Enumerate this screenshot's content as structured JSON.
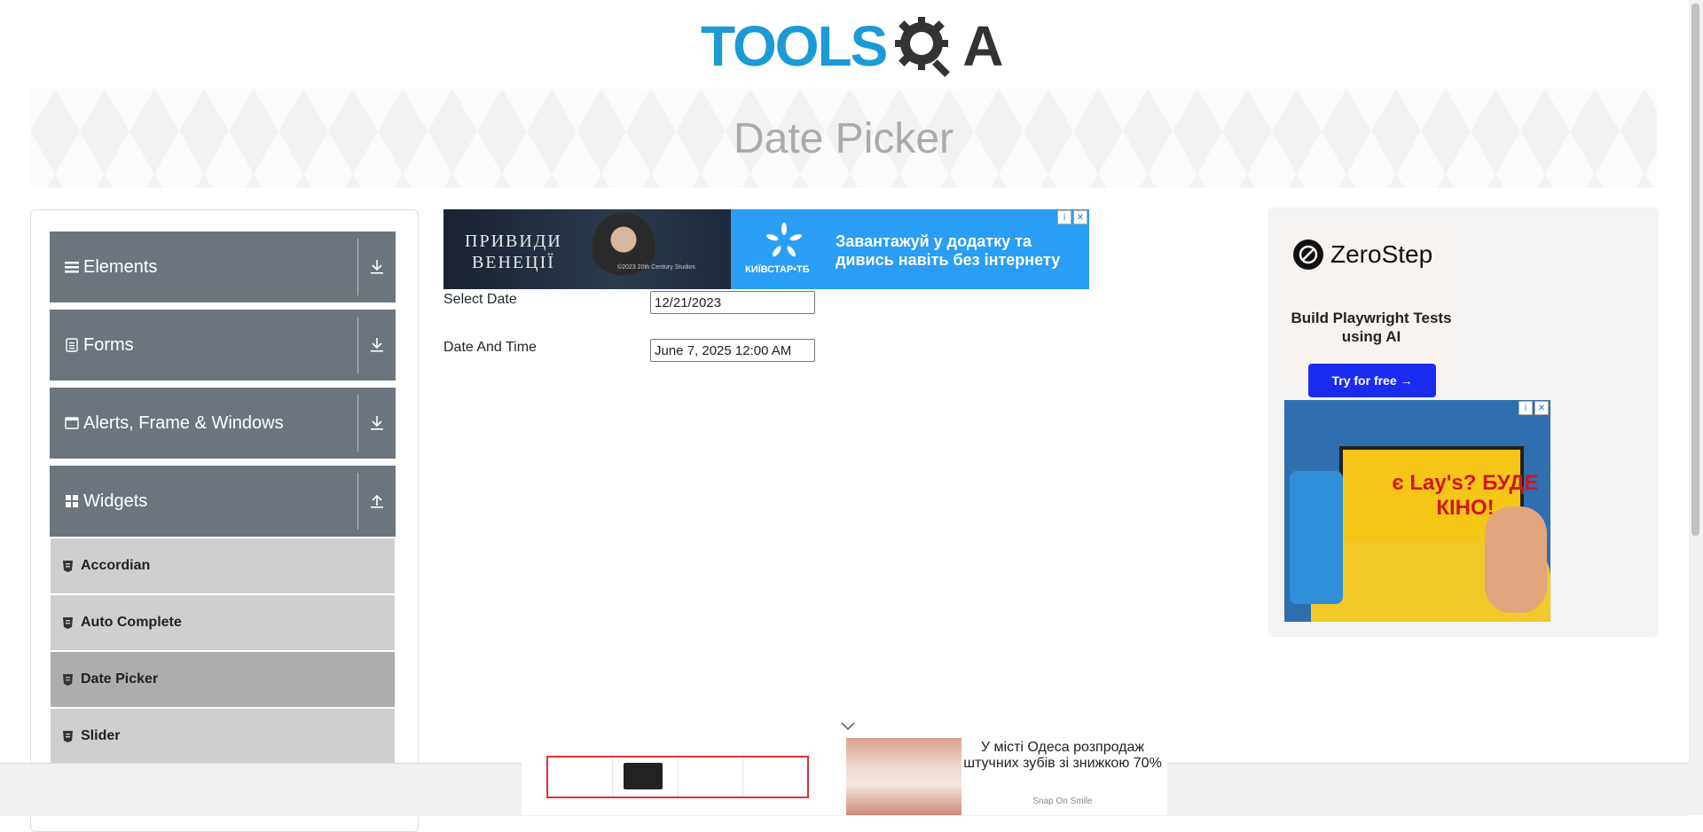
{
  "header": {
    "logo_text_left": "TOOLS",
    "logo_text_right": "A"
  },
  "banner": {
    "title": "Date Picker"
  },
  "sidebar": {
    "groups": [
      {
        "label": "Elements",
        "icon": "hamburger-icon",
        "expanded": false
      },
      {
        "label": "Forms",
        "icon": "document-icon",
        "expanded": false
      },
      {
        "label": "Alerts, Frame & Windows",
        "icon": "window-icon",
        "expanded": false
      },
      {
        "label": "Widgets",
        "icon": "grid-icon",
        "expanded": true
      }
    ],
    "items": [
      {
        "label": "Accordian",
        "active": false
      },
      {
        "label": "Auto Complete",
        "active": false
      },
      {
        "label": "Date Picker",
        "active": true
      },
      {
        "label": "Slider",
        "active": false
      }
    ]
  },
  "ad_top": {
    "left_title": "ПРИВИДИ\nВЕНЕЦІЇ",
    "left_copyright": "©2023 20th Century Studios",
    "right_brand": "КИЇВСТАР•ТБ",
    "right_message": "Завантажуй у додатку та дивись навіть без інтернету"
  },
  "form": {
    "select_date_label": "Select Date",
    "select_date_value": "12/21/2023",
    "date_time_label": "Date And Time",
    "date_time_value": "June 7, 2025 12:00 AM"
  },
  "right_ad": {
    "brand": "ZeroStep",
    "tagline": "Build Playwright Tests using AI",
    "cta": "Try for free →",
    "lays_text": "є Lay's? БУДЕ КІНО!"
  },
  "bottom_ad": {
    "headline": "У місті Одеса розпродаж штучних зубів зі знижкою 70%",
    "source": "Snap On Smile"
  },
  "colors": {
    "sidebar_header": "#6c757d",
    "sidebar_item": "#cfcfcf",
    "sidebar_item_active": "#adadad",
    "logo_blue": "#1c9ad6",
    "cta_blue": "#1a2cf0"
  }
}
